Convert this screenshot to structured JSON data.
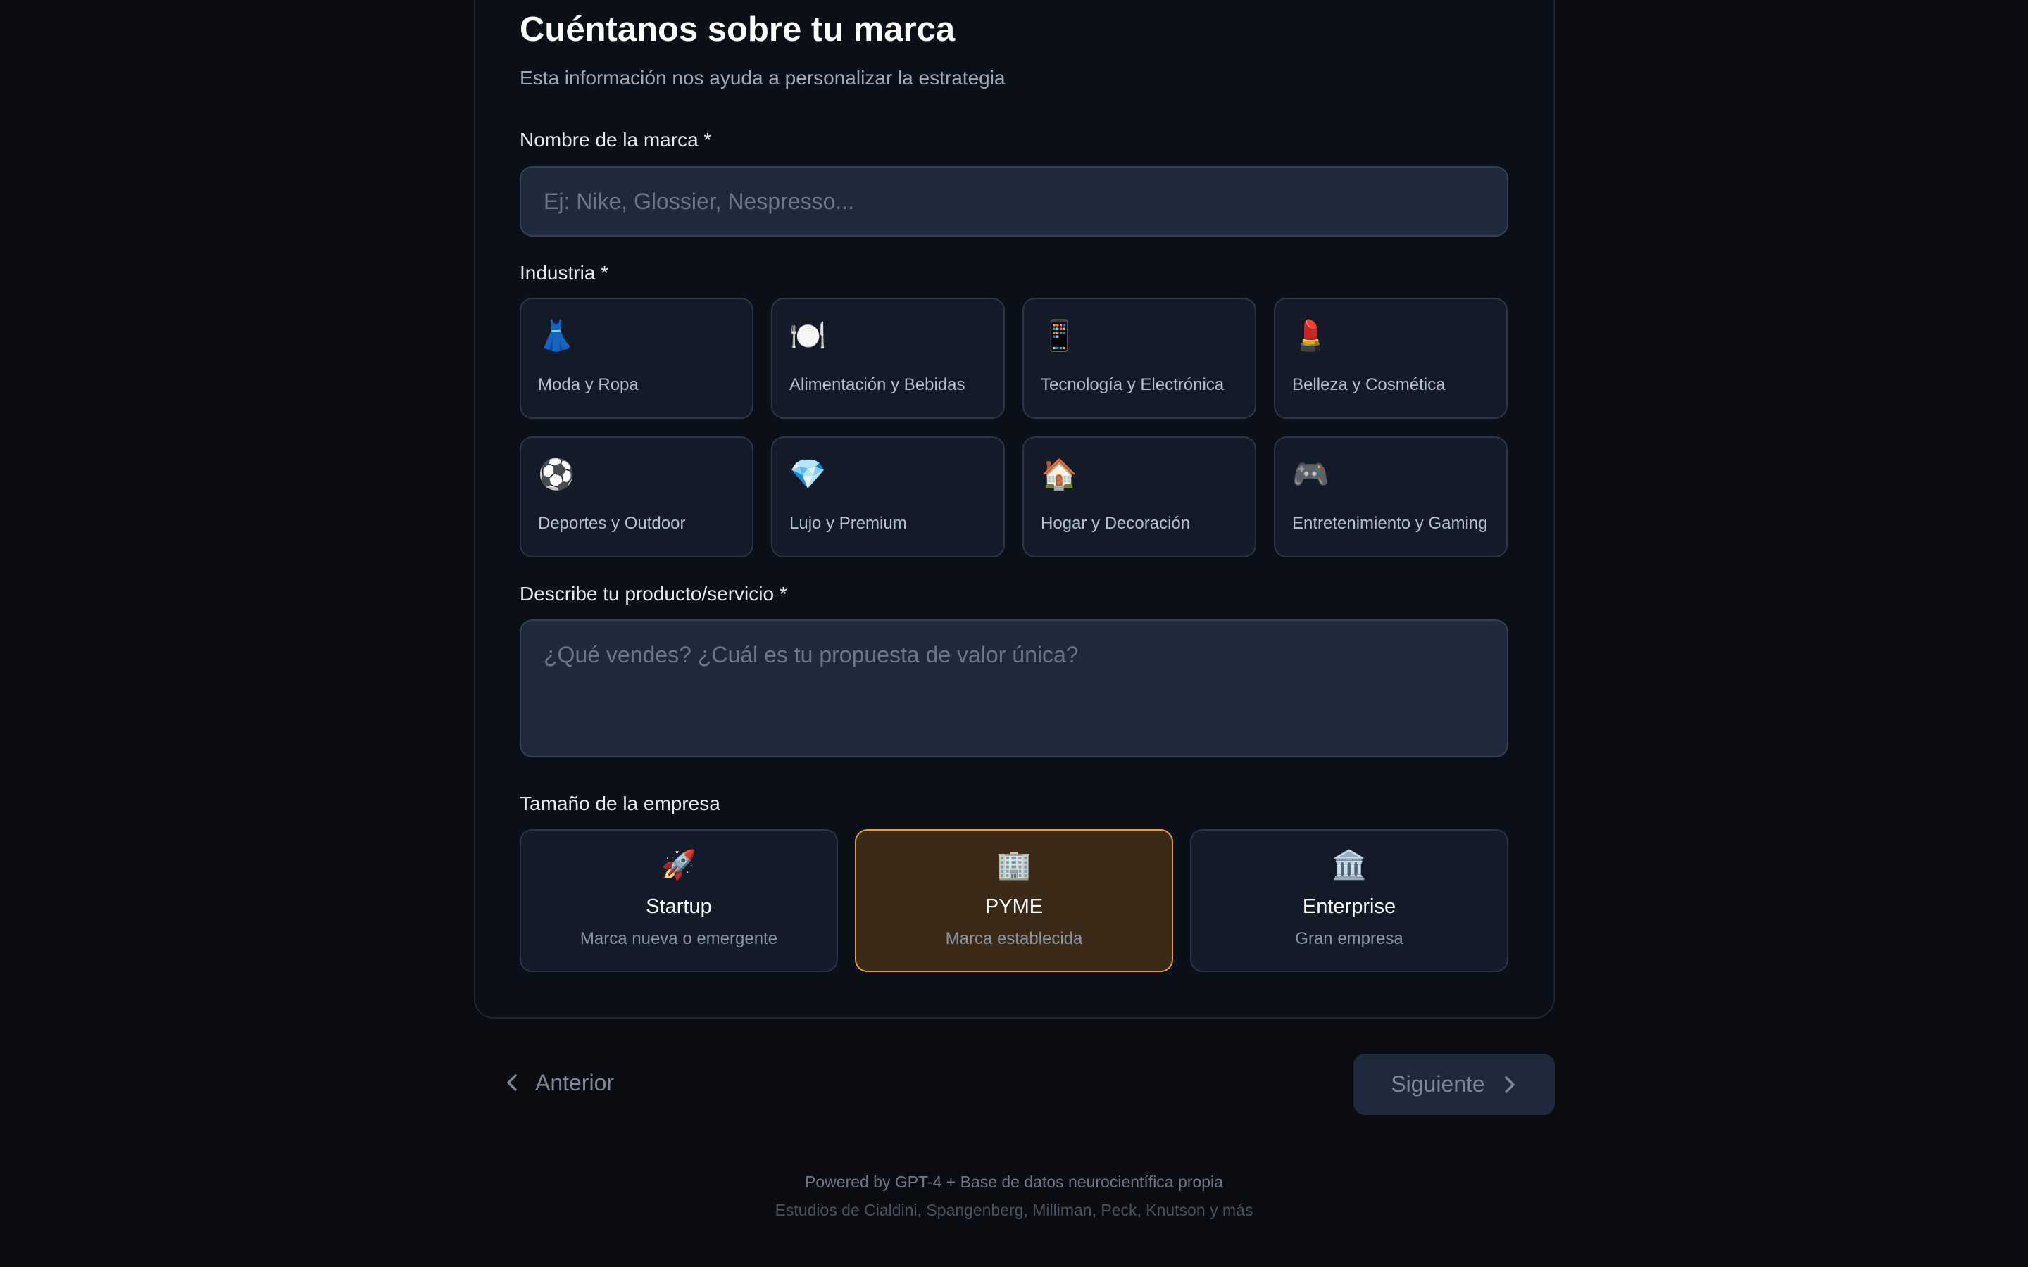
{
  "header": {
    "title": "Cuéntanos sobre tu marca",
    "subtitle": "Esta información nos ayuda a personalizar la estrategia"
  },
  "brand_name": {
    "label": "Nombre de la marca *",
    "placeholder": "Ej: Nike, Glossier, Nespresso...",
    "value": ""
  },
  "industry": {
    "label": "Industria *",
    "options": [
      {
        "icon": "👗",
        "icon_name": "dress-icon",
        "label": "Moda y Ropa"
      },
      {
        "icon": "🍽️",
        "icon_name": "plate-icon",
        "label": "Alimentación y Bebidas"
      },
      {
        "icon": "📱",
        "icon_name": "smartphone-icon",
        "label": "Tecnología y Electrónica"
      },
      {
        "icon": "💄",
        "icon_name": "lipstick-icon",
        "label": "Belleza y Cosmética"
      },
      {
        "icon": "⚽",
        "icon_name": "soccer-ball-icon",
        "label": "Deportes y Outdoor"
      },
      {
        "icon": "💎",
        "icon_name": "diamond-icon",
        "label": "Lujo y Premium"
      },
      {
        "icon": "🏠",
        "icon_name": "house-icon",
        "label": "Hogar y Decoración"
      },
      {
        "icon": "🎮",
        "icon_name": "gamepad-icon",
        "label": "Entretenimiento y Gaming"
      }
    ]
  },
  "description": {
    "label": "Describe tu producto/servicio *",
    "placeholder": "¿Qué vendes? ¿Cuál es tu propuesta de valor única?",
    "value": ""
  },
  "company_size": {
    "label": "Tamaño de la empresa",
    "selected": "PYME",
    "options": [
      {
        "icon": "🚀",
        "icon_name": "rocket-icon",
        "name": "Startup",
        "desc": "Marca nueva o emergente"
      },
      {
        "icon": "🏢",
        "icon_name": "office-building-icon",
        "name": "PYME",
        "desc": "Marca establecida"
      },
      {
        "icon": "🏛️",
        "icon_name": "classical-building-icon",
        "name": "Enterprise",
        "desc": "Gran empresa"
      }
    ]
  },
  "nav": {
    "prev_label": "Anterior",
    "next_label": "Siguiente"
  },
  "footer": {
    "line1": "Powered by GPT-4 + Base de datos neurocientífica propia",
    "line2": "Estudios de Cialdini, Spangenberg, Milliman, Peck, Knutson y más"
  },
  "colors": {
    "background": "#0a0c12",
    "card": "#0b0f18",
    "input": "#1e293b",
    "selected_border": "#e8a035",
    "selected_fill": "#3a2a17"
  }
}
